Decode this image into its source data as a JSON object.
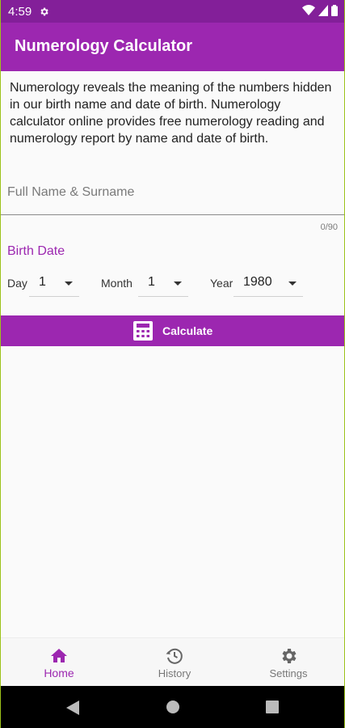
{
  "status_bar": {
    "time": "4:59"
  },
  "app_bar": {
    "title": "Numerology Calculator"
  },
  "intro_text": "Numerology reveals the meaning of the numbers hidden in our birth name and date of birth. Numerology calculator online provides free numerology reading and numerology report by name and date of birth.",
  "name_field": {
    "placeholder": "Full Name & Surname",
    "value": "",
    "counter": "0/90"
  },
  "birth_date": {
    "label": "Birth Date",
    "day": {
      "label": "Day",
      "value": "1"
    },
    "month": {
      "label": "Month",
      "value": "1"
    },
    "year": {
      "label": "Year",
      "value": "1980"
    }
  },
  "calculate_button": {
    "label": "Calculate",
    "icon": "calculator-icon"
  },
  "bottom_nav": {
    "items": [
      {
        "label": "Home",
        "icon": "home-icon",
        "active": true
      },
      {
        "label": "History",
        "icon": "history-icon",
        "active": false
      },
      {
        "label": "Settings",
        "icon": "settings-icon",
        "active": false
      }
    ]
  },
  "colors": {
    "primary": "#9c27b0",
    "status_bar": "#831f99",
    "background": "#fafafa"
  }
}
